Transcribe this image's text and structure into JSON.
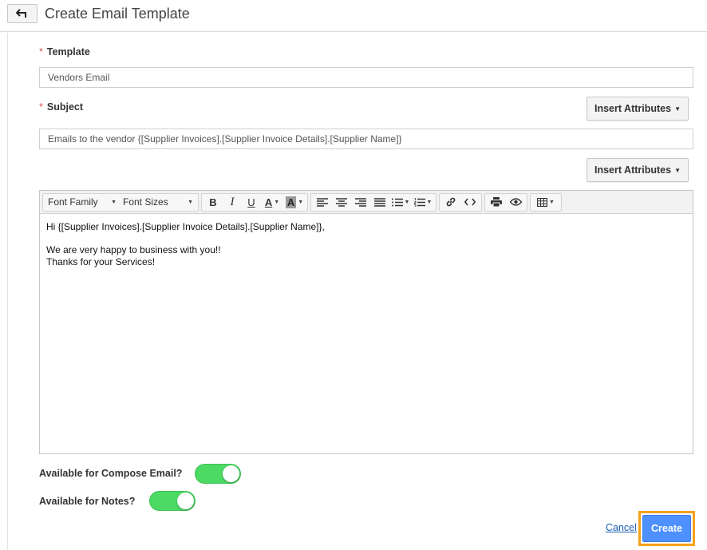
{
  "header": {
    "back_icon": "back-arrow-icon",
    "title": "Create Email Template"
  },
  "form": {
    "template": {
      "required_mark": "*",
      "label": "Template",
      "value": "Vendors Email"
    },
    "subject": {
      "required_mark": "*",
      "label": "Subject",
      "value": "Emails to the vendor {[Supplier Invoices].[Supplier Invoice Details].[Supplier Name]}"
    },
    "insert_attributes_label": "Insert Attributes"
  },
  "editor": {
    "toolbar": {
      "font_family": "Font Family",
      "font_sizes": "Font Sizes",
      "bold": "B",
      "italic": "I",
      "underline": "U",
      "font_color": "A",
      "highlight_color": "A"
    },
    "body_lines": [
      "Hi {[Supplier Invoices].[Supplier Invoice Details].[Supplier Name]},",
      "",
      "We are very happy to business with you!!",
      "Thanks for your Services!"
    ]
  },
  "toggles": {
    "compose_email": {
      "label": "Available for Compose Email?",
      "on": true
    },
    "notes": {
      "label": "Available for Notes?",
      "on": true
    }
  },
  "actions": {
    "cancel": "Cancel",
    "create": "Create"
  },
  "colors": {
    "toggle_on": "#4cd964",
    "create_button": "#4d90fe",
    "focus_outline": "#f5a11c",
    "required": "#d9534f"
  }
}
